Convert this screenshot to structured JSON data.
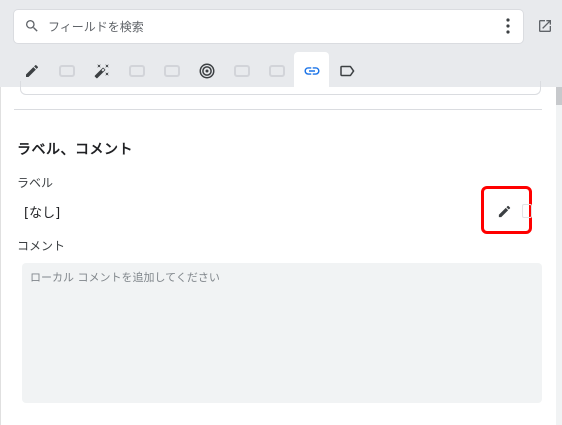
{
  "search": {
    "placeholder": "フィールドを検索",
    "value": ""
  },
  "tabs": [
    {
      "icon": "pencil-icon",
      "state": "normal"
    },
    {
      "icon": "disabled-icon",
      "state": "disabled"
    },
    {
      "icon": "magic-wand-icon",
      "state": "normal"
    },
    {
      "icon": "disabled-icon",
      "state": "disabled"
    },
    {
      "icon": "disabled-icon",
      "state": "disabled"
    },
    {
      "icon": "target-icon",
      "state": "normal"
    },
    {
      "icon": "disabled-icon",
      "state": "disabled"
    },
    {
      "icon": "disabled-icon",
      "state": "disabled"
    },
    {
      "icon": "link-icon",
      "state": "active"
    },
    {
      "icon": "label-tag-icon",
      "state": "normal"
    }
  ],
  "section": {
    "title": "ラベル、コメント",
    "label_heading": "ラベル",
    "label_value": "[なし]",
    "comment_heading": "コメント",
    "comment_placeholder": "ローカル コメントを追加してください",
    "comment_value": ""
  },
  "colors": {
    "accent": "#1a73e8",
    "highlight": "#ff0000",
    "top_bg": "#e8eaed"
  }
}
